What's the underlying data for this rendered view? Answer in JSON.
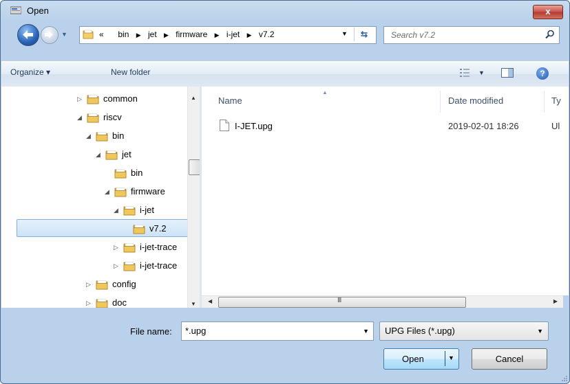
{
  "window": {
    "title": "Open",
    "close_label": "x"
  },
  "address": {
    "crumbs_prefix": "«",
    "crumbs": [
      "bin",
      "jet",
      "firmware",
      "i-jet",
      "v7.2"
    ]
  },
  "search": {
    "placeholder": "Search v7.2"
  },
  "toolbar": {
    "organize_label": "Organize ▾",
    "new_folder_label": "New folder",
    "help_label": "?"
  },
  "nav_tree": [
    {
      "label": "common",
      "expander": "▷"
    },
    {
      "label": "riscv",
      "expander": "◢"
    },
    {
      "label": "bin",
      "expander": "◢"
    },
    {
      "label": "jet",
      "expander": "◢"
    },
    {
      "label": "bin",
      "expander": ""
    },
    {
      "label": "firmware",
      "expander": "◢"
    },
    {
      "label": "i-jet",
      "expander": "◢"
    },
    {
      "label": "v7.2",
      "expander": "",
      "selected": true
    },
    {
      "label": "i-jet-trace",
      "expander": "▷"
    },
    {
      "label": "i-jet-trace",
      "expander": "▷"
    },
    {
      "label": "config",
      "expander": "▷"
    },
    {
      "label": "doc",
      "expander": "▷"
    }
  ],
  "columns": {
    "name": "Name",
    "date": "Date modified",
    "type": "Ty"
  },
  "files": [
    {
      "name": "I-JET.upg",
      "date": "2019-02-01 18:26",
      "type": "Ul"
    }
  ],
  "hscroll": {
    "grip": "III"
  },
  "bottom": {
    "filename_label": "File name:",
    "filename_value": "*.upg",
    "filter_value": "UPG Files (*.upg)",
    "open_label": "Open",
    "cancel_label": "Cancel"
  },
  "colors": {
    "selection": "#cce3f7",
    "accent": "#3c7fb1",
    "close": "#c75050"
  }
}
